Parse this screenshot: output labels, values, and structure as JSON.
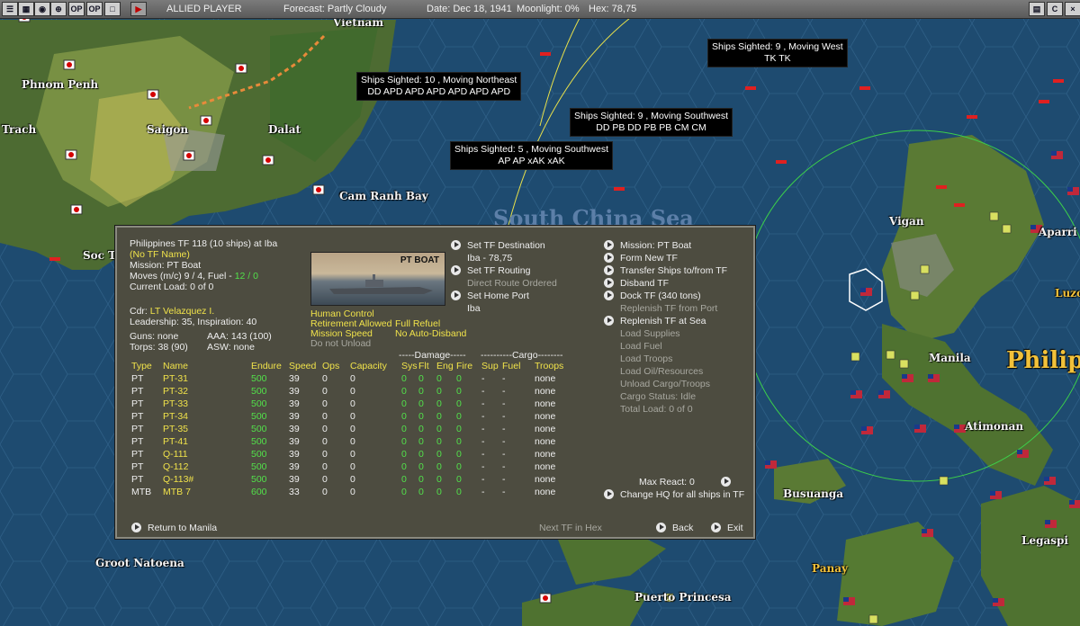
{
  "topbar": {
    "player": "ALLIED PLAYER",
    "forecast": "Forecast: Partly Cloudy",
    "date": "Date: Dec 18, 1941",
    "moonlight": "Moonlight: 0%",
    "hex": "Hex: 78,75",
    "buttons": [
      "OP",
      "OP"
    ]
  },
  "map": {
    "place_labels": [
      "Phnom Penh",
      "Trach",
      "Saigon",
      "Dalat",
      "Vietnam",
      "Cam Ranh Bay",
      "Soc Tr",
      "Vigan",
      "Aparri",
      "Luzo",
      "Manila",
      "Philip",
      "Atimonan",
      "Busuanga",
      "Legaspi",
      "Panay",
      "Puerto Princesa",
      "Groot Natoena",
      "South China Sea"
    ]
  },
  "sightings": [
    {
      "title": "Ships Sighted: 10 , Moving Northeast",
      "ships": "DD APD APD APD APD APD APD"
    },
    {
      "title": "Ships Sighted: 9 , Moving West",
      "ships": "TK TK"
    },
    {
      "title": "Ships Sighted: 9 , Moving Southwest",
      "ships": "DD PB DD PB PB CM CM"
    },
    {
      "title": "Ships Sighted: 5 , Moving Southwest",
      "ships": "AP AP xAK xAK"
    }
  ],
  "panel": {
    "header": "Philippines TF 118 (10 ships) at Iba",
    "tf_name": "(No TF Name)",
    "mission": "Mission: PT Boat",
    "moves_label": "Moves (m/c) 9 / 4, Fuel -",
    "moves_fuel": "12 / 0",
    "current_load": "Current Load: 0 of 0",
    "cdr_label": "Cdr:",
    "cdr_name": "LT Velazquez I.",
    "leadership": "Leadership: 35, Inspiration: 40",
    "guns": "Guns: none",
    "aaa": "AAA: 143 (100)",
    "torps": "Torps: 38 (90)",
    "asw": "ASW: none",
    "ship_image_caption": "PT BOAT",
    "human_control": "Human Control",
    "retirement": "Retirement Allowed",
    "full_refuel": "Full Refuel",
    "mission_speed": "Mission Speed",
    "no_auto_disband": "No Auto-Disband",
    "do_not_unload": "Do not Unload",
    "mid_menu": {
      "set_destination": "Set TF Destination",
      "destination": "Iba - 78,75",
      "set_routing": "Set TF Routing",
      "direct_route": "Direct Route Ordered",
      "set_home": "Set Home Port",
      "home": "Iba"
    },
    "right_menu": [
      {
        "label": "Mission: PT Boat",
        "enabled": true,
        "arrow": true
      },
      {
        "label": "Form New TF",
        "enabled": true,
        "arrow": true
      },
      {
        "label": "Transfer Ships to/from TF",
        "enabled": true,
        "arrow": true
      },
      {
        "label": "Disband TF",
        "enabled": true,
        "arrow": true
      },
      {
        "label": "Dock TF (340 tons)",
        "enabled": true,
        "arrow": true
      },
      {
        "label": "Replenish TF from Port",
        "enabled": false,
        "arrow": false
      },
      {
        "label": "Replenish TF at Sea",
        "enabled": true,
        "arrow": true
      },
      {
        "label": "Load Supplies",
        "enabled": false,
        "arrow": false
      },
      {
        "label": "Load Fuel",
        "enabled": false,
        "arrow": false
      },
      {
        "label": "Load Troops",
        "enabled": false,
        "arrow": false
      },
      {
        "label": "Load Oil/Resources",
        "enabled": false,
        "arrow": false
      },
      {
        "label": "Unload Cargo/Troops",
        "enabled": false,
        "arrow": false
      },
      {
        "label": "Cargo Status: Idle",
        "enabled": false,
        "arrow": false
      },
      {
        "label": "Total Load: 0 of 0",
        "enabled": false,
        "arrow": false
      }
    ],
    "max_react": "Max React: 0",
    "change_hq": "Change HQ for all ships in TF",
    "damage_header": "-----Damage-----",
    "cargo_header": "----------Cargo--------",
    "columns": [
      "Type",
      "Name",
      "Endure",
      "Speed",
      "Ops",
      "Capacity",
      "Sys",
      "Flt",
      "Eng",
      "Fire",
      "Sup",
      "Fuel",
      "Troops"
    ],
    "ships": [
      [
        "PT",
        "PT-31",
        "500",
        "39",
        "0",
        "0",
        "0",
        "0",
        "0",
        "0",
        "-",
        "-",
        "none"
      ],
      [
        "PT",
        "PT-32",
        "500",
        "39",
        "0",
        "0",
        "0",
        "0",
        "0",
        "0",
        "-",
        "-",
        "none"
      ],
      [
        "PT",
        "PT-33",
        "500",
        "39",
        "0",
        "0",
        "0",
        "0",
        "0",
        "0",
        "-",
        "-",
        "none"
      ],
      [
        "PT",
        "PT-34",
        "500",
        "39",
        "0",
        "0",
        "0",
        "0",
        "0",
        "0",
        "-",
        "-",
        "none"
      ],
      [
        "PT",
        "PT-35",
        "500",
        "39",
        "0",
        "0",
        "0",
        "0",
        "0",
        "0",
        "-",
        "-",
        "none"
      ],
      [
        "PT",
        "PT-41",
        "500",
        "39",
        "0",
        "0",
        "0",
        "0",
        "0",
        "0",
        "-",
        "-",
        "none"
      ],
      [
        "PT",
        "Q-111",
        "500",
        "39",
        "0",
        "0",
        "0",
        "0",
        "0",
        "0",
        "-",
        "-",
        "none"
      ],
      [
        "PT",
        "Q-112",
        "500",
        "39",
        "0",
        "0",
        "0",
        "0",
        "0",
        "0",
        "-",
        "-",
        "none"
      ],
      [
        "PT",
        "Q-113#",
        "500",
        "39",
        "0",
        "0",
        "0",
        "0",
        "0",
        "0",
        "-",
        "-",
        "none"
      ],
      [
        "MTB",
        "MTB 7",
        "600",
        "33",
        "0",
        "0",
        "0",
        "0",
        "0",
        "0",
        "-",
        "-",
        "none"
      ]
    ],
    "return_label": "Return to Manila",
    "next_tf": "Next TF in Hex",
    "back": "Back",
    "exit": "Exit"
  },
  "colors": {
    "allied_flag": "#b22234",
    "japan_flag": "#d40000",
    "panel_bg": "#4d4c40",
    "highlight_yellow": "#f0e24a",
    "highlight_green": "#52e04a"
  }
}
